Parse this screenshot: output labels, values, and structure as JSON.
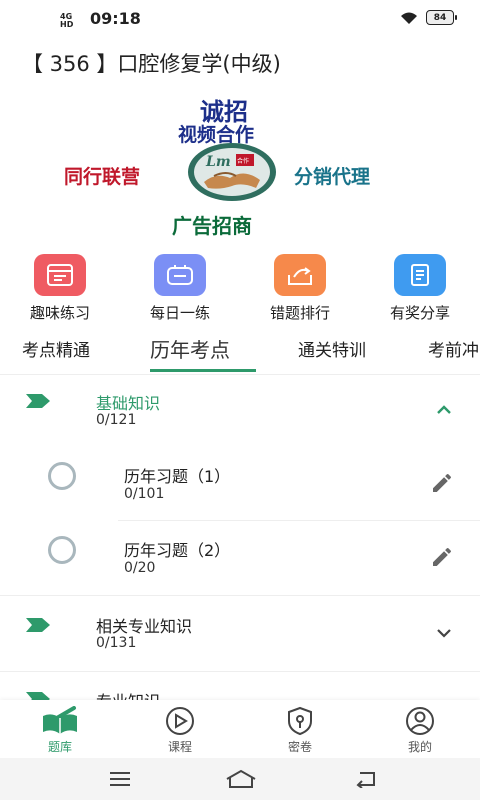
{
  "status_bar": {
    "network": "4G\nHD",
    "time": "09:18",
    "battery": "84"
  },
  "header": {
    "title": "【 356 】口腔修复学(中级)"
  },
  "banner": {
    "line1": "诚招",
    "line2": "视频合作",
    "left": "同行联营",
    "right": "分销代理",
    "bottom": "广告招商",
    "logo_text": "Lm",
    "logo_badge": "合作 共赢"
  },
  "actions": [
    {
      "label": "趣味练习",
      "icon": "practice-icon",
      "color": "#ef5b62"
    },
    {
      "label": "每日一练",
      "icon": "daily-icon",
      "color": "#7b8ff5"
    },
    {
      "label": "错题排行",
      "icon": "ranking-icon",
      "color": "#f6894b"
    },
    {
      "label": "有奖分享",
      "icon": "share-icon",
      "color": "#3f9bf0"
    }
  ],
  "tabs": [
    "考点精通",
    "历年考点",
    "通关特训",
    "考前冲"
  ],
  "active_tab": "历年考点",
  "accent": "#2e9a6b",
  "sections": [
    {
      "name": "基础知识",
      "count": "0/121",
      "expanded": true,
      "children": [
        {
          "name": "历年习题（1）",
          "count": "0/101"
        },
        {
          "name": "历年习题（2）",
          "count": "0/20"
        }
      ]
    },
    {
      "name": "相关专业知识",
      "count": "0/131",
      "expanded": false
    },
    {
      "name": "专业知识",
      "count": "",
      "expanded": false
    }
  ],
  "bottom_nav": [
    {
      "label": "题库",
      "icon": "book-icon",
      "active": true
    },
    {
      "label": "课程",
      "icon": "play-icon",
      "active": false
    },
    {
      "label": "密卷",
      "icon": "lock-shield-icon",
      "active": false
    },
    {
      "label": "我的",
      "icon": "profile-icon",
      "active": false
    }
  ]
}
